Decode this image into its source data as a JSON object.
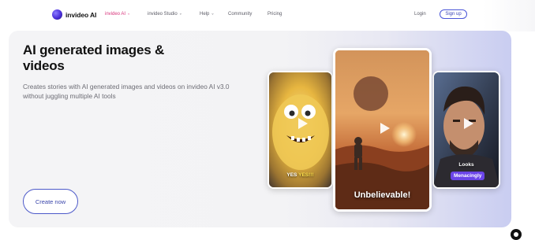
{
  "nav": {
    "brand": "invideo AI",
    "items": [
      {
        "label": "invideo AI",
        "chevron": true,
        "active": true
      },
      {
        "label": "invideo Studio",
        "chevron": true,
        "active": false
      },
      {
        "label": "Help",
        "chevron": true,
        "active": false
      },
      {
        "label": "Community",
        "chevron": false,
        "active": false
      },
      {
        "label": "Pricing",
        "chevron": false,
        "active": false
      }
    ],
    "login": "Login",
    "signup": "Sign up"
  },
  "hero": {
    "title": "AI generated images & videos",
    "subtitle": "Creates stories with AI generated images and videos on invideo AI v3.0 without juggling multiple AI tools",
    "cta": "Create now"
  },
  "cards": {
    "monster": {
      "caption_prefix": "YES",
      "caption_highlight": "YES!!!"
    },
    "astronaut": {
      "caption": "Unbelievable!"
    },
    "man": {
      "caption_top": "Looks",
      "caption_pill": "Menacingly"
    }
  },
  "colors": {
    "accent": "#d8347b",
    "primary": "#4a56d8",
    "pill": "#6b45e8"
  }
}
